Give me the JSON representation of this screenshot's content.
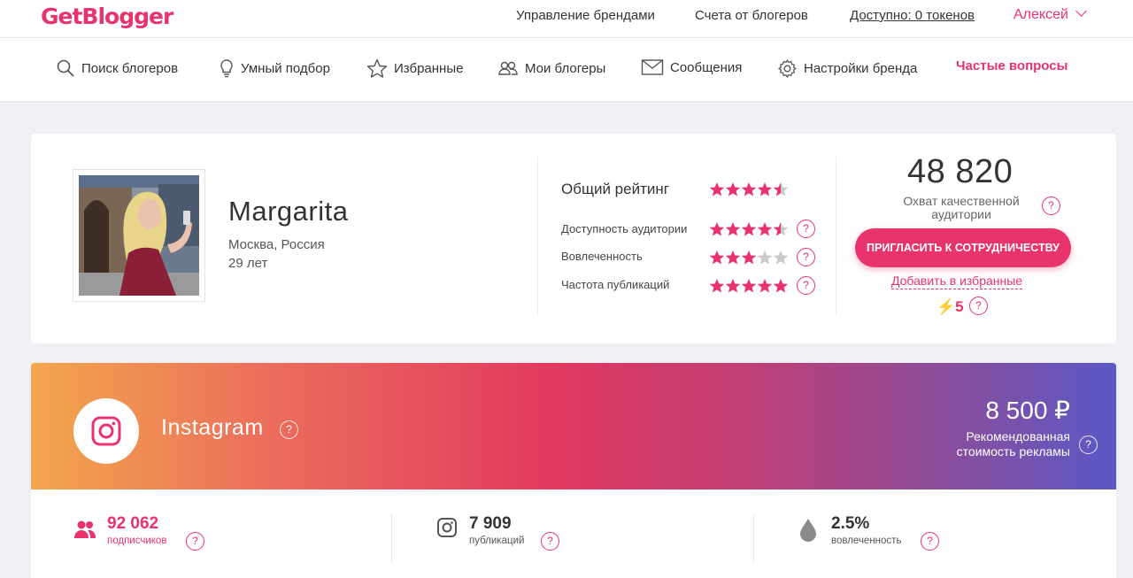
{
  "brand": {
    "logo": "GetBlogger",
    "accent": "#e8336d"
  },
  "topbar": {
    "links": [
      "Управление брендами",
      "Счета от блогеров",
      "Доступно: 0 токенов"
    ],
    "user": "Алексей"
  },
  "nav": {
    "items": [
      {
        "label": "Поиск блогеров",
        "icon": "search-icon"
      },
      {
        "label": "Умный подбор",
        "icon": "lightbulb-icon"
      },
      {
        "label": "Избранные",
        "icon": "star-icon"
      },
      {
        "label": "Мои блогеры",
        "icon": "users-icon"
      },
      {
        "label": "Сообщения",
        "icon": "envelope-icon"
      },
      {
        "label": "Настройки бренда",
        "icon": "gear-icon"
      },
      {
        "label": "Частые вопросы",
        "icon": ""
      }
    ]
  },
  "profile": {
    "name": "Margarita",
    "city": "Москва, Россия",
    "age": "29 лет"
  },
  "ratings": {
    "overall": {
      "label": "Общий рейтинг",
      "stars": 4.5
    },
    "rows": [
      {
        "label": "Доступность аудитории",
        "stars": 4.5,
        "help": "?"
      },
      {
        "label": "Вовлеченность",
        "stars": 3,
        "help": "?"
      },
      {
        "label": "Частота публикаций",
        "stars": 5,
        "help": "?"
      }
    ]
  },
  "reach": {
    "value": "48 820",
    "label": "Охват качественной аудитории",
    "help": "?"
  },
  "actions": {
    "invite": "ПРИГЛАСИТЬ К СОТРУДНИЧЕСТВУ",
    "favorite": "Добавить в избранные",
    "tokens": "5",
    "help": "?"
  },
  "network": {
    "name": "Instagram",
    "help": "?",
    "price": "8 500 ₽",
    "price_label_1": "Рекомендованная",
    "price_label_2": "стоимость рекламы"
  },
  "stats": [
    {
      "value": "92 062",
      "label": "подписчиков",
      "icon": "users-icon",
      "help": "?"
    },
    {
      "value": "7 909",
      "label": "публикаций",
      "icon": "instagram-icon",
      "help": "?"
    },
    {
      "value": "2.5%",
      "label": "вовлеченность",
      "icon": "drop-icon",
      "help": "?"
    }
  ]
}
